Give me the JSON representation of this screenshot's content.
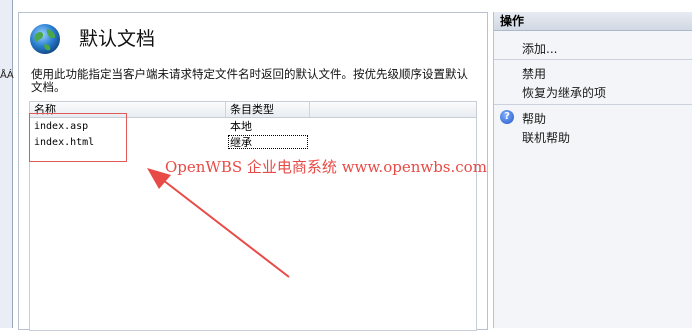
{
  "left_panel": {
    "edge_label": "ÅÁ"
  },
  "main": {
    "title": "默认文档",
    "description": "使用此功能指定当客户端未请求特定文件名时返回的默认文件。按优先级顺序设置默认文档。",
    "list": {
      "columns": [
        "名称",
        "条目类型"
      ],
      "rows": [
        {
          "name": "index.asp",
          "type": "本地"
        },
        {
          "name": "index.html",
          "type": "继承"
        }
      ]
    }
  },
  "annotation": {
    "text": "OpenWBS 企业电商系统 www.openwbs.com",
    "color": "#e84b46"
  },
  "actions": {
    "header": "操作",
    "items": {
      "add": "添加...",
      "disable": "禁用",
      "revert": "恢复为继承的项",
      "help": "帮助",
      "online_help": "联机帮助"
    }
  },
  "icons": {
    "globe": "globe-icon",
    "help": "help-icon"
  }
}
